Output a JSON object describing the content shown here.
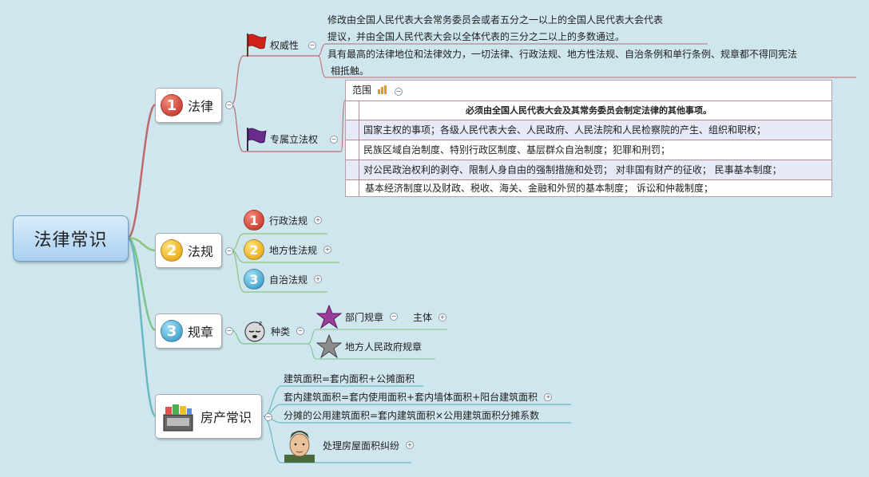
{
  "root": {
    "label": "法律常识"
  },
  "law": {
    "label": "法律",
    "num": "1",
    "authority": {
      "label": "权威性",
      "desc1_l1": "修改由全国人民代表大会常务委员会或者五分之一以上的全国人民代表大会代表",
      "desc1_l2": "提议，并由全国人民代表大会以全体代表的三分之二以上的多数通过。",
      "desc2_l1": "具有最高的法律地位和法律效力，一切法律、行政法规、地方性法规、自治条例和单行条例、规章都不得同宪法",
      "desc2_l2": "相抵触。"
    },
    "exclusive": {
      "label": "专属立法权",
      "scope_label": "范围",
      "rows": [
        "必须由全国人民代表大会及其常务委员会制定法律的其他事项。",
        "国家主权的事项；各级人民代表大会、人民政府、人民法院和人民检察院的产生、组织和职权；",
        "民族区域自治制度、特别行政区制度、基层群众自治制度；犯罪和刑罚；",
        "对公民政治权利的剥夺、限制人身自由的强制措施和处罚；   对非国有财产的征收；   民事基本制度；",
        "基本经济制度以及财政、税收、海关、金融和外贸的基本制度；   诉讼和仲裁制度；"
      ]
    }
  },
  "regulation": {
    "label": "法规",
    "num": "2",
    "items": [
      {
        "num": "1",
        "label": "行政法规"
      },
      {
        "num": "2",
        "label": "地方性法规"
      },
      {
        "num": "3",
        "label": "自治法规"
      }
    ]
  },
  "rules": {
    "label": "规章",
    "num": "3",
    "kind": {
      "label": "种类"
    },
    "dept": {
      "label": "部门规章",
      "sub": "主体"
    },
    "local": {
      "label": "地方人民政府规章"
    }
  },
  "property": {
    "label": "房产常识",
    "items": [
      "建筑面积=套内面积+公摊面积",
      "套内建筑面积=套内使用面积+套内墙体面积+阳台建筑面积",
      "分摊的公用建筑面积=套内建筑面积×公用建筑面积分摊系数",
      "处理房屋面积纠纷"
    ]
  },
  "symbols": {
    "collapse": "−",
    "expand": "+"
  }
}
